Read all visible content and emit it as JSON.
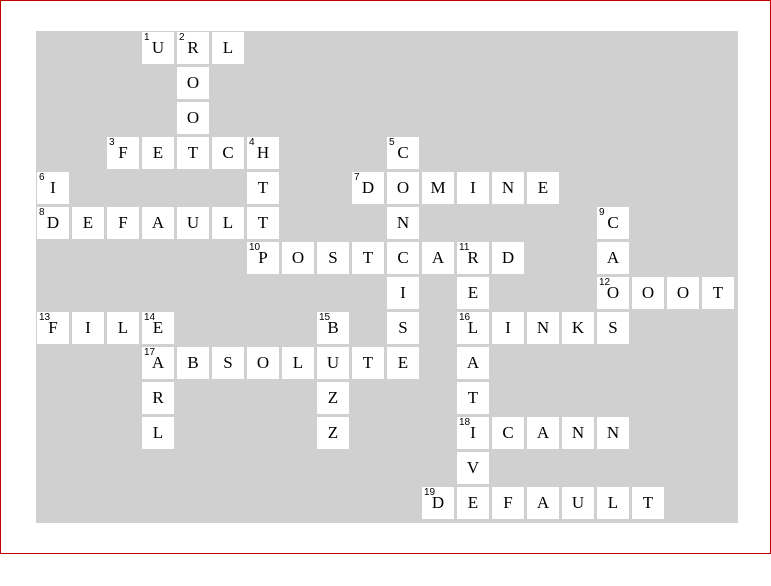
{
  "colors": {
    "frame_border": "#c00000",
    "board_background": "#d0d0d0",
    "cell_background": "#ffffff",
    "text": "#000000"
  },
  "crossword": {
    "rows": 14,
    "cols": 20,
    "entries": [
      {
        "number": 1,
        "direction": "across",
        "row": 0,
        "col": 3,
        "answer": "URL"
      },
      {
        "number": 2,
        "direction": "down",
        "row": 0,
        "col": 4,
        "answer": "ROO"
      },
      {
        "number": 3,
        "direction": "across",
        "row": 3,
        "col": 2,
        "answer": "FETCH"
      },
      {
        "number": 4,
        "direction": "down",
        "row": 3,
        "col": 6,
        "answer": "HTT"
      },
      {
        "number": 5,
        "direction": "down",
        "row": 3,
        "col": 10,
        "answer": "CONCISE"
      },
      {
        "number": 6,
        "direction": "down",
        "row": 4,
        "col": 0,
        "answer": "ID"
      },
      {
        "number": 7,
        "direction": "across",
        "row": 4,
        "col": 9,
        "answer": "DOMINE"
      },
      {
        "number": 8,
        "direction": "across",
        "row": 5,
        "col": 0,
        "answer": "DEFAULT"
      },
      {
        "number": 9,
        "direction": "down",
        "row": 5,
        "col": 16,
        "answer": "CAOS"
      },
      {
        "number": 10,
        "direction": "across",
        "row": 6,
        "col": 6,
        "answer": "POSTCARD"
      },
      {
        "number": 11,
        "direction": "down",
        "row": 6,
        "col": 12,
        "answer": "RELATIVE"
      },
      {
        "number": 12,
        "direction": "across",
        "row": 7,
        "col": 16,
        "answer": "ROOT"
      },
      {
        "number": 13,
        "direction": "across",
        "row": 8,
        "col": 0,
        "answer": "FILE"
      },
      {
        "number": 14,
        "direction": "down",
        "row": 8,
        "col": 3,
        "answer": "EARL"
      },
      {
        "number": 15,
        "direction": "down",
        "row": 8,
        "col": 8,
        "answer": "BUZZ"
      },
      {
        "number": 16,
        "direction": "across",
        "row": 8,
        "col": 12,
        "answer": "LINKS"
      },
      {
        "number": 17,
        "direction": "across",
        "row": 9,
        "col": 3,
        "answer": "ABSOLUTE"
      },
      {
        "number": 18,
        "direction": "across",
        "row": 11,
        "col": 12,
        "answer": "ICANN"
      },
      {
        "number": 19,
        "direction": "across",
        "row": 13,
        "col": 11,
        "answer": "DEFAULT"
      }
    ]
  }
}
